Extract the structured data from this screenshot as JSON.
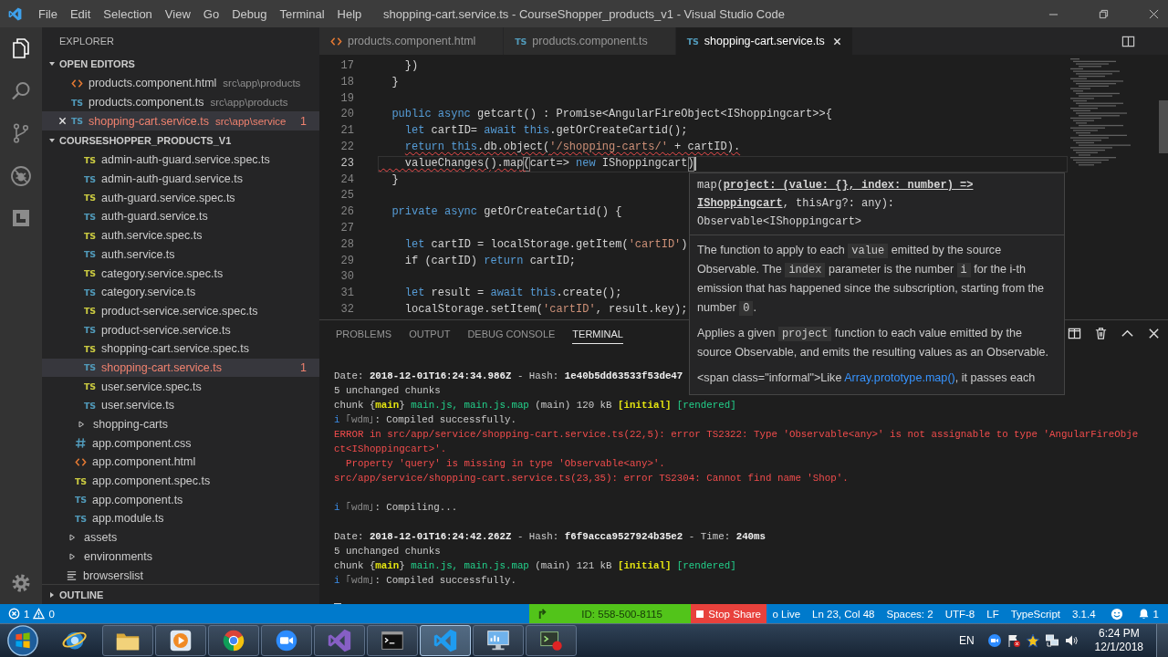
{
  "window": {
    "title": "shopping-cart.service.ts - CourseShopper_products_v1 - Visual Studio Code"
  },
  "menu": [
    "File",
    "Edit",
    "Selection",
    "View",
    "Go",
    "Debug",
    "Terminal",
    "Help"
  ],
  "activity_bar": [
    {
      "kind": "explorer",
      "selected": true
    },
    {
      "kind": "search",
      "selected": false
    },
    {
      "kind": "source-control",
      "selected": false
    },
    {
      "kind": "debug",
      "selected": false
    },
    {
      "kind": "extensions",
      "selected": false
    }
  ],
  "sidebar": {
    "title": "EXPLORER",
    "open_editors": {
      "title": "OPEN EDITORS",
      "expanded": true,
      "items": [
        {
          "name": "products.component.html",
          "path": "src\\app\\products",
          "kind": "html",
          "selected": false
        },
        {
          "name": "products.component.ts",
          "path": "src\\app\\products",
          "kind": "ts",
          "icon_text": "TS",
          "selected": false
        },
        {
          "name": "shopping-cart.service.ts",
          "path": "src\\app\\service",
          "kind": "ts",
          "icon_text": "TS",
          "selected": true,
          "problems": "1"
        }
      ]
    },
    "project": {
      "title": "COURSESHOPPER_PRODUCTS_V1",
      "expanded": true,
      "tree": [
        {
          "children": [
            {
              "children": [
                {
                  "children": [
                    {
                      "name": "admin-auth-guard.service.spec.ts",
                      "kind": "ts-spec",
                      "icon_text": "TS",
                      "selected": false
                    },
                    {
                      "name": "admin-auth-guard.service.ts",
                      "kind": "ts",
                      "icon_text": "TS",
                      "selected": false
                    },
                    {
                      "name": "auth-guard.service.spec.ts",
                      "kind": "ts-spec",
                      "icon_text": "TS",
                      "selected": false
                    },
                    {
                      "name": "auth-guard.service.ts",
                      "kind": "ts",
                      "icon_text": "TS",
                      "selected": false
                    },
                    {
                      "name": "auth.service.spec.ts",
                      "kind": "ts-spec",
                      "icon_text": "TS",
                      "selected": false
                    },
                    {
                      "name": "auth.service.ts",
                      "kind": "ts",
                      "icon_text": "TS",
                      "selected": false
                    },
                    {
                      "name": "category.service.spec.ts",
                      "kind": "ts-spec",
                      "icon_text": "TS",
                      "selected": false
                    },
                    {
                      "name": "category.service.ts",
                      "kind": "ts",
                      "icon_text": "TS",
                      "selected": false
                    },
                    {
                      "name": "product-service.service.spec.ts",
                      "kind": "ts-spec",
                      "icon_text": "TS",
                      "selected": false
                    },
                    {
                      "name": "product-service.service.ts",
                      "kind": "ts",
                      "icon_text": "TS",
                      "selected": false
                    },
                    {
                      "name": "shopping-cart.service.spec.ts",
                      "kind": "ts-spec",
                      "icon_text": "TS",
                      "selected": false
                    },
                    {
                      "name": "shopping-cart.service.ts",
                      "kind": "ts",
                      "icon_text": "TS",
                      "selected": true,
                      "problems": "1"
                    },
                    {
                      "name": "user.service.spec.ts",
                      "kind": "ts-spec",
                      "icon_text": "TS",
                      "selected": false
                    },
                    {
                      "name": "user.service.ts",
                      "kind": "ts",
                      "icon_text": "TS",
                      "selected": false
                    }
                  ]
                },
                {
                  "name": "shopping-carts",
                  "kind": "folder",
                  "expanded": false,
                  "selected": false
                },
                {
                  "name": "app.component.css",
                  "kind": "css",
                  "selected": false
                },
                {
                  "name": "app.component.html",
                  "kind": "html",
                  "selected": false
                },
                {
                  "name": "app.component.spec.ts",
                  "kind": "ts-spec",
                  "icon_text": "TS",
                  "selected": false
                },
                {
                  "name": "app.component.ts",
                  "kind": "ts",
                  "icon_text": "TS",
                  "selected": false
                },
                {
                  "name": "app.module.ts",
                  "kind": "ts",
                  "icon_text": "TS",
                  "selected": false
                }
              ]
            },
            {
              "name": "assets",
              "kind": "folder",
              "expanded": false,
              "selected": false
            },
            {
              "name": "environments",
              "kind": "folder",
              "expanded": false,
              "selected": false
            },
            {
              "name": "browserslist",
              "kind": "config",
              "selected": false
            }
          ]
        }
      ]
    },
    "outline": {
      "title": "OUTLINE",
      "expanded": false
    }
  },
  "tabs": [
    {
      "label": "products.component.html",
      "kind": "html",
      "selected": false
    },
    {
      "label": "products.component.ts",
      "kind": "ts",
      "icon_text": "TS",
      "selected": false
    },
    {
      "label": "shopping-cart.service.ts",
      "kind": "ts",
      "icon_text": "TS",
      "selected": true
    }
  ],
  "editor": {
    "lines": [
      {
        "number": "17",
        "current": false,
        "tokens": [
          {
            "text": "    })",
            "kind": "plain",
            "error": false
          }
        ]
      },
      {
        "number": "18",
        "current": false,
        "tokens": [
          {
            "text": "  }",
            "kind": "plain",
            "error": false
          }
        ]
      },
      {
        "number": "19",
        "current": false
      },
      {
        "number": "20",
        "current": false,
        "tokens": [
          {
            "text": "  public async",
            "kind": "keyword",
            "error": false
          },
          {
            "text": " getcart() : Promise<AngularFireObject<IShoppingcart>>{",
            "kind": "plain",
            "error": false
          }
        ]
      },
      {
        "number": "21",
        "current": false,
        "tokens": [
          {
            "text": "    let",
            "kind": "keyword",
            "error": false
          },
          {
            "text": " cartID= ",
            "kind": "plain",
            "error": false
          },
          {
            "text": "await this",
            "kind": "keyword",
            "error": false
          },
          {
            "text": ".getOrCreateCartid();",
            "kind": "plain",
            "error": false
          }
        ]
      },
      {
        "number": "22",
        "current": false,
        "tokens": [
          {
            "text": "    return this",
            "kind": "keyword",
            "error": true
          },
          {
            "text": ".db.object(",
            "kind": "plain",
            "error": true
          },
          {
            "text": "'/shopping-carts/'",
            "kind": "string",
            "error": true
          },
          {
            "text": " + cartID).",
            "kind": "plain",
            "error": true
          }
        ]
      },
      {
        "number": "23",
        "current": true,
        "tokens": [
          {
            "text": "    valueChanges().map",
            "kind": "plain",
            "error": true
          },
          {
            "text": "(",
            "kind": "bracket",
            "error": true
          },
          {
            "text": "cart=> ",
            "kind": "plain",
            "error": false
          },
          {
            "text": "new",
            "kind": "keyword",
            "error": false
          },
          {
            "text": " IShoppingcart",
            "kind": "plain",
            "error": false
          },
          {
            "text": ")",
            "kind": "bracket",
            "error": false
          }
        ]
      },
      {
        "number": "24",
        "current": false,
        "tokens": [
          {
            "text": "  }",
            "kind": "plain",
            "error": false
          }
        ]
      },
      {
        "number": "25",
        "current": false
      },
      {
        "number": "26",
        "current": false,
        "tokens": [
          {
            "text": "  private async",
            "kind": "keyword",
            "error": false
          },
          {
            "text": " getOrCreateCartid() {",
            "kind": "plain",
            "error": false
          }
        ]
      },
      {
        "number": "27",
        "current": false
      },
      {
        "number": "28",
        "current": false,
        "tokens": [
          {
            "text": "    let",
            "kind": "keyword",
            "error": false
          },
          {
            "text": " cartID = localStorage.getItem(",
            "kind": "plain",
            "error": false
          },
          {
            "text": "'cartID'",
            "kind": "string",
            "error": false
          },
          {
            "text": ")",
            "kind": "plain",
            "error": false
          }
        ]
      },
      {
        "number": "29",
        "current": false,
        "tokens": [
          {
            "text": "    if (cartID) ",
            "kind": "plain",
            "error": false
          },
          {
            "text": "return",
            "kind": "keyword",
            "error": false
          },
          {
            "text": " cartID;",
            "kind": "plain",
            "error": false
          }
        ]
      },
      {
        "number": "30",
        "current": false
      },
      {
        "number": "31",
        "current": false,
        "tokens": [
          {
            "text": "    let",
            "kind": "keyword",
            "error": false
          },
          {
            "text": " result = ",
            "kind": "plain",
            "error": false
          },
          {
            "text": "await this",
            "kind": "keyword",
            "error": false
          },
          {
            "text": ".create();",
            "kind": "plain",
            "error": false
          }
        ]
      },
      {
        "number": "32",
        "current": false,
        "tokens": [
          {
            "text": "    localStorage.setItem(",
            "kind": "plain",
            "error": false
          },
          {
            "text": "'cartID'",
            "kind": "string",
            "error": false
          },
          {
            "text": ", result.key);",
            "kind": "plain",
            "error": false
          }
        ]
      }
    ]
  },
  "hover": {
    "signature": "map(**project: (value: {}, index: number) => IShoppingcart**, thisArg?: any): Observable<IShoppingcart>",
    "paragraphs": [
      [
        {
          "kind": "text",
          "text": "The function to apply to each "
        },
        {
          "kind": "code",
          "text": "value"
        },
        {
          "kind": "text",
          "text": " emitted by the source Observable. The "
        },
        {
          "kind": "code",
          "text": "index"
        },
        {
          "kind": "text",
          "text": " parameter is the number "
        },
        {
          "kind": "code",
          "text": "i"
        },
        {
          "kind": "text",
          "text": " for the i-th emission that has happened since the subscription, starting from the number "
        },
        {
          "kind": "code",
          "text": "0"
        },
        {
          "kind": "text",
          "text": "."
        }
      ],
      [
        {
          "kind": "text",
          "text": "Applies a given "
        },
        {
          "kind": "code",
          "text": "project"
        },
        {
          "kind": "text",
          "text": " function to each value emitted by the source Observable, and emits the resulting values as an Observable."
        }
      ],
      [
        {
          "kind": "text",
          "text": "<span class=\"informal\">Like "
        },
        {
          "kind": "link",
          "text": "Array.prototype.map()"
        },
        {
          "kind": "text",
          "text": ", it passes each"
        }
      ]
    ]
  },
  "panel": {
    "tabs": [
      {
        "label": "PROBLEMS",
        "selected": false
      },
      {
        "label": "OUTPUT",
        "selected": false
      },
      {
        "label": "DEBUG CONSOLE",
        "selected": false
      },
      {
        "label": "TERMINAL",
        "selected": true
      }
    ],
    "terminal": {
      "cursor": true,
      "blocks": [
        [
          [
            {
              "text": "Date: ",
              "kind": "plain"
            },
            {
              "text": "2018-12-01T16:24:34.986Z",
              "kind": "bright"
            },
            {
              "text": " - Hash: ",
              "kind": "plain"
            },
            {
              "text": "1e40b5dd63533f53de47",
              "kind": "bright"
            }
          ],
          [
            {
              "text": "5 unchanged chunks",
              "kind": "plain"
            }
          ],
          [
            {
              "text": "chunk {",
              "kind": "plain"
            },
            {
              "text": "main",
              "kind": "yellow"
            },
            {
              "text": "} ",
              "kind": "plain"
            },
            {
              "text": "main.js, main.js.map",
              "kind": "green"
            },
            {
              "text": " (main) 120 kB ",
              "kind": "plain"
            },
            {
              "text": "[initial] ",
              "kind": "yellow"
            },
            {
              "text": "[rendered]",
              "kind": "green"
            }
          ],
          [
            {
              "text": "i",
              "kind": "blue"
            },
            {
              "text": " ｢wdm｣",
              "kind": "dim"
            },
            {
              "text": ": Compiled successfully.",
              "kind": "plain"
            }
          ],
          [
            {
              "text": "ERROR in src/app/service/shopping-cart.service.ts(22,5): error TS2322: Type 'Observable<any>' is not assignable to type 'AngularFireObje",
              "kind": "red"
            }
          ],
          [
            {
              "text": "ct<IShoppingcart>'.",
              "kind": "red"
            }
          ],
          [
            {
              "text": "  Property 'query' is missing in type 'Observable<any>'.",
              "kind": "red"
            }
          ],
          [
            {
              "text": "src/app/service/shopping-cart.service.ts(23,35): error TS2304: Cannot find name 'Shop'.",
              "kind": "red"
            }
          ]
        ],
        [
          [
            {
              "text": "i",
              "kind": "blue"
            },
            {
              "text": " ｢wdm｣",
              "kind": "dim"
            },
            {
              "text": ": Compiling...",
              "kind": "plain"
            }
          ]
        ],
        [
          [
            {
              "text": "Date: ",
              "kind": "plain"
            },
            {
              "text": "2018-12-01T16:24:42.262Z",
              "kind": "bright"
            },
            {
              "text": " - Hash: ",
              "kind": "plain"
            },
            {
              "text": "f6f9acca9527924b35e2",
              "kind": "bright"
            },
            {
              "text": " - Time: ",
              "kind": "plain"
            },
            {
              "text": "240ms",
              "kind": "bright"
            }
          ],
          [
            {
              "text": "5 unchanged chunks",
              "kind": "plain"
            }
          ],
          [
            {
              "text": "chunk {",
              "kind": "plain"
            },
            {
              "text": "main",
              "kind": "yellow"
            },
            {
              "text": "} ",
              "kind": "plain"
            },
            {
              "text": "main.js, main.js.map",
              "kind": "green"
            },
            {
              "text": " (main) 121 kB ",
              "kind": "plain"
            },
            {
              "text": "[initial] ",
              "kind": "yellow"
            },
            {
              "text": "[rendered]",
              "kind": "green"
            }
          ],
          [
            {
              "text": "i",
              "kind": "blue"
            },
            {
              "text": " ｢wdm｣",
              "kind": "dim"
            },
            {
              "text": ": Compiled successfully.",
              "kind": "plain"
            }
          ]
        ]
      ]
    }
  },
  "status_bar": {
    "errors": "1",
    "warnings": "0",
    "items": [
      "o Live",
      "Ln 23, Col 48",
      "Spaces: 2",
      "UTF-8",
      "LF",
      "TypeScript",
      "3.1.4"
    ],
    "notifications": "1"
  },
  "screen_share": {
    "id": "ID: 558-500-8115",
    "stop": "Stop Share"
  },
  "taskbar": {
    "apps": [
      {
        "kind": "browser-e",
        "running": false,
        "selected": false
      },
      {
        "kind": "folder",
        "running": true,
        "selected": false
      },
      {
        "kind": "media",
        "running": true,
        "selected": false
      },
      {
        "kind": "browser-ring",
        "running": true,
        "selected": false
      },
      {
        "kind": "video",
        "running": true,
        "selected": false
      },
      {
        "kind": "ide",
        "running": true,
        "selected": false
      },
      {
        "kind": "console",
        "running": true,
        "selected": false
      },
      {
        "kind": "editor",
        "running": true,
        "selected": true
      },
      {
        "kind": "control-panel",
        "running": true,
        "selected": false
      },
      {
        "kind": "app",
        "running": true,
        "selected": false
      }
    ],
    "language": "EN",
    "time": "6:24 PM",
    "date": "12/1/2018"
  }
}
